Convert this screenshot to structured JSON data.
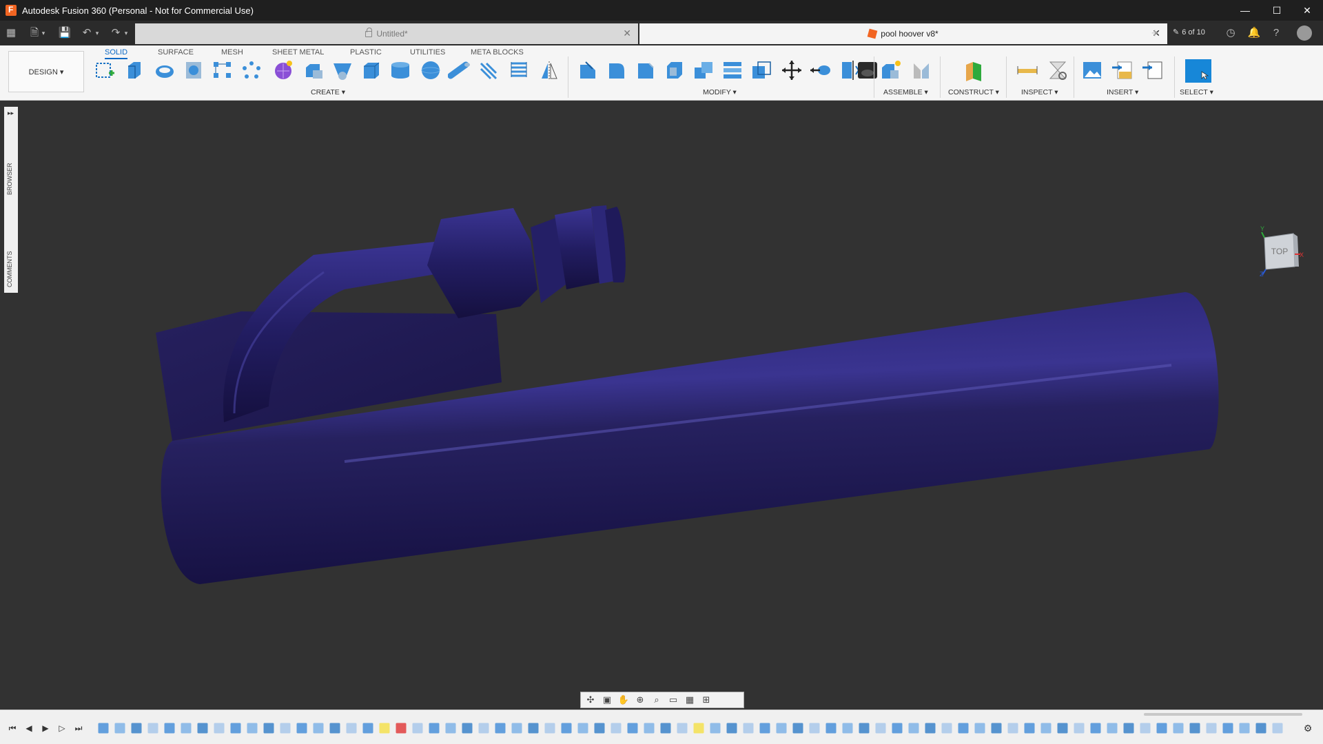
{
  "window": {
    "title": "Autodesk Fusion 360 (Personal - Not for Commercial Use)",
    "controls": {
      "minimize": "—",
      "maximize": "☐",
      "close": "✕"
    }
  },
  "tabs": {
    "untitled": {
      "label": "Untitled*",
      "close": "✕"
    },
    "active": {
      "label": "pool hoover v8*",
      "close": "✕"
    },
    "job_count": "6 of 10"
  },
  "ribbon": {
    "workspace_label": "DESIGN ▾",
    "tabs": [
      "SOLID",
      "SURFACE",
      "MESH",
      "SHEET METAL",
      "PLASTIC",
      "UTILITIES",
      "META BLOCKS"
    ],
    "groups": {
      "create": "CREATE ▾",
      "modify": "MODIFY ▾",
      "assemble": "ASSEMBLE ▾",
      "construct": "CONSTRUCT ▾",
      "inspect": "INSPECT ▾",
      "insert": "INSERT ▾",
      "select": "SELECT ▾"
    }
  },
  "side_panel": {
    "browser": "BROWSER",
    "comments": "COMMENTS"
  },
  "viewcube": {
    "face": "TOP",
    "axis_y": "Y",
    "axis_x": "X",
    "axis_z": "Z"
  },
  "colors": {
    "model_body": "#1e1a5c",
    "accent": "#0a68c4",
    "select_tool": "#1787d8",
    "timeline_highlight": "#f5e050",
    "timeline_error": "#e04040"
  }
}
